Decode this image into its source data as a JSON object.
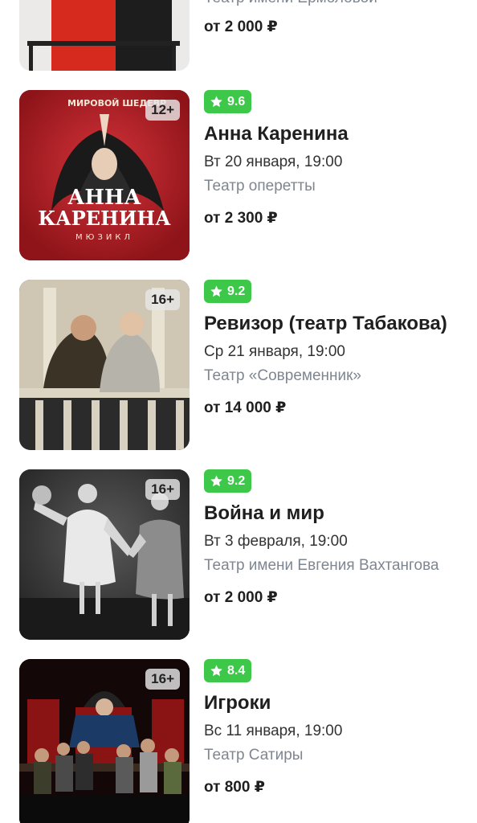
{
  "partial": {
    "venue": "Театр имени Ермоловой",
    "price": "от 2 000 ₽"
  },
  "events": [
    {
      "age": "12+",
      "rating": "9.6",
      "title": "Анна Каренина",
      "date": "Вт 20 января, 19:00",
      "venue": "Театр оперетты",
      "price": "от 2 300 ₽",
      "poster": {
        "top_text": "МИРОВОЙ ШЕДЕВР",
        "main_text_1": "АННА",
        "main_text_2": "КАРЕНИНА",
        "sub_text": "МЮЗИКЛ"
      }
    },
    {
      "age": "16+",
      "rating": "9.2",
      "title": "Ревизор (театр Табакова)",
      "date": "Ср 21 января, 19:00",
      "venue": "Театр «Современник»",
      "price": "от 14 000 ₽"
    },
    {
      "age": "16+",
      "rating": "9.2",
      "title": "Война и мир",
      "date": "Вт 3 февраля, 19:00",
      "venue": "Театр имени Евгения Вахтангова",
      "price": "от 2 000 ₽"
    },
    {
      "age": "16+",
      "rating": "8.4",
      "title": "Игроки",
      "date": "Вс 11 января, 19:00",
      "venue": "Театр Сатиры",
      "price": "от 800 ₽"
    }
  ],
  "colors": {
    "rating_badge": "#3ec84a",
    "venue_text": "#7e8690"
  },
  "icons": {
    "rating": "star-icon"
  }
}
